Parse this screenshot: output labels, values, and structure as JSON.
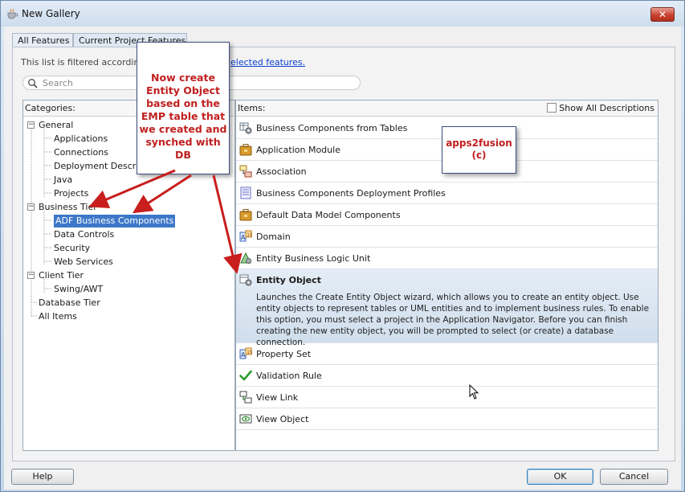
{
  "window": {
    "title": "New Gallery",
    "close_glyph": "✕"
  },
  "tabs": [
    {
      "label": "All Features"
    },
    {
      "label": "Current Project Features"
    }
  ],
  "filter": {
    "message": "This list is filtered according to",
    "link": "elected features."
  },
  "search": {
    "placeholder": "Search"
  },
  "categories": {
    "header": "Categories:",
    "general": "General",
    "applications": "Applications",
    "connections": "Connections",
    "deployment": "Deployment Descriptors",
    "java": "Java",
    "projects": "Projects",
    "business_tier": "Business Tier",
    "adf_bc": "ADF Business Components",
    "data_controls": "Data Controls",
    "security": "Security",
    "web_services": "Web Services",
    "client_tier": "Client Tier",
    "swing": "Swing/AWT",
    "database_tier": "Database Tier",
    "all_items": "All Items"
  },
  "items": {
    "header": "Items:",
    "show_all": "Show All Descriptions",
    "list": [
      {
        "label": "Business Components from Tables"
      },
      {
        "label": "Application Module"
      },
      {
        "label": "Association"
      },
      {
        "label": "Business Components Deployment Profiles"
      },
      {
        "label": "Default Data Model Components"
      },
      {
        "label": "Domain"
      },
      {
        "label": "Entity Business Logic Unit"
      },
      {
        "label": "Entity Object",
        "description": "Launches the Create Entity Object wizard, which allows you to create an entity object. Use entity objects to represent tables or UML entities and to implement business rules. To enable this option, you must select a project in the Application Navigator. Before you can finish creating the new entity object, you will be prompted to select (or create) a database connection."
      },
      {
        "label": "Property Set"
      },
      {
        "label": "Validation Rule"
      },
      {
        "label": "View Link"
      },
      {
        "label": "View Object"
      }
    ]
  },
  "buttons": {
    "help": "Help",
    "ok": "OK",
    "cancel": "Cancel"
  },
  "annotations": {
    "callout_main": "Now create Entity Object based on the EMP table that we created and synched with DB",
    "callout_credit_line1": "apps2fusion",
    "callout_credit_line2": "(c)"
  },
  "colors": {
    "selection": "#3d78c8",
    "annotation_text": "#c02020",
    "arrow": "#c81e1e"
  }
}
